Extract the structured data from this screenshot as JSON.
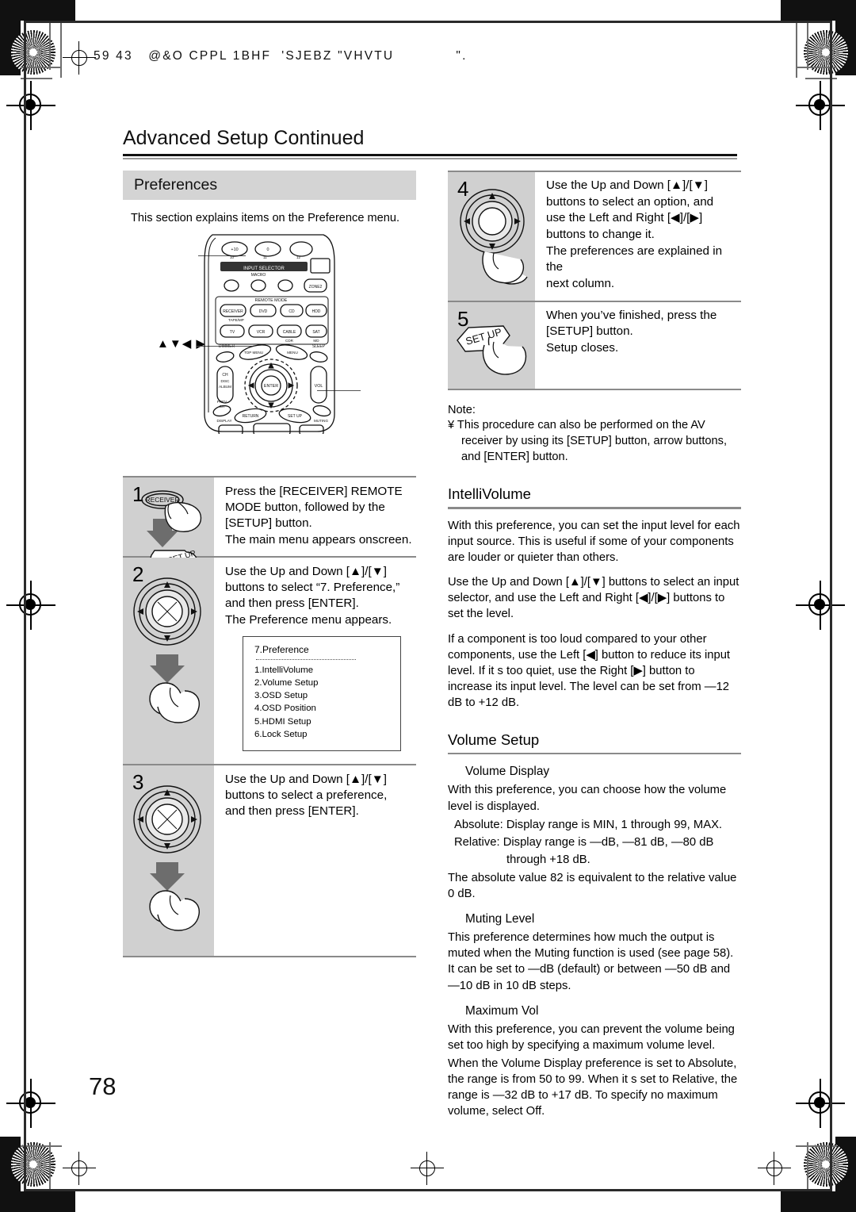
{
  "scan_header": "59 43   @&O CPPL 1BHF  'SJEBZ \"VHVTU            \".",
  "page_title": "Advanced Setup Continued",
  "page_number": "78",
  "left_column": {
    "section_band": "Preferences",
    "intro": "This section explains items on the  Preference  menu.",
    "arrow_label": "▲▼◀ ▶",
    "remote": {
      "caption_buttons": [
        "+10",
        "0",
        "INPUT SELECTOR",
        "MACRO",
        "1",
        "2",
        "3",
        "ZONE2",
        "REMOTE MODE",
        "RECEIVER",
        "DVD",
        "CD",
        "HDD",
        "TV",
        "VCR",
        "CABLE",
        "SAT",
        "TAPE/MP",
        "CDR",
        "MD",
        "DIMMER",
        "SLEEP",
        "TOP MENU",
        "MENU",
        "CH",
        "DISC",
        "ALBUM",
        "ENTER",
        "VOL",
        "PREV CH",
        "RETURN",
        "SET UP",
        "DISPLAY",
        "MUTING"
      ]
    },
    "steps": [
      {
        "num": "1",
        "icon": "receiver-setup-hand-icon",
        "lines": [
          "Press the [RECEIVER] REMOTE",
          "MODE button, followed by the",
          "[SETUP] button.",
          "The main menu appears onscreen."
        ]
      },
      {
        "num": "2",
        "icon": "dial-hand-icon",
        "lines": [
          "Use the Up and Down [▲]/[▼]",
          "buttons to select “7. Preference,”",
          "and then press [ENTER].",
          "The Preference menu appears."
        ],
        "osd": {
          "title": "7.Preference",
          "items": [
            "1.IntelliVolume",
            "2.Volume Setup",
            "3.OSD Setup",
            "4.OSD Position",
            "5.HDMI Setup",
            "6.Lock Setup"
          ]
        }
      },
      {
        "num": "3",
        "icon": "dial-hand-icon",
        "lines": [
          "Use the Up and Down [▲]/[▼]",
          "buttons to select a preference,",
          "and then press [ENTER]."
        ]
      }
    ]
  },
  "right_column": {
    "steps": [
      {
        "num": "4",
        "icon": "dial-hand-icon",
        "lines": [
          "Use the Up and Down [▲]/[▼]",
          "buttons to select an option, and",
          "use the Left and Right [◀]/[▶]",
          "buttons to change it.",
          "The preferences are explained in the",
          "next column."
        ]
      },
      {
        "num": "5",
        "icon": "setup-hand-icon",
        "button_label": "SET UP",
        "lines": [
          "When you’ve finished, press the",
          "[SETUP] button.",
          "Setup closes."
        ]
      }
    ],
    "note": {
      "label": "Note:",
      "bullet": "¥",
      "text": "This procedure can also be performed on the AV receiver by using its [SETUP] button, arrow buttons, and [ENTER] button."
    },
    "intellivolume": {
      "heading": "IntelliVolume",
      "paragraphs": [
        "With this preference, you can set the input level for each input source. This is useful if some of your components are louder or quieter than others.",
        "Use the Up and Down [▲]/[▼] buttons to select an input selector, and use the Left and Right [◀]/[▶] buttons to set the level.",
        "If a component is too loud compared to your other components, use the Left [◀] button to reduce its input level. If it s too quiet, use the Right [▶] button to increase its input level. The level can be set from —12 dB to +12 dB."
      ]
    },
    "volume_setup": {
      "heading": "Volume Setup",
      "subsections": [
        {
          "title": "Volume Display",
          "paragraphs": [
            "With this preference, you can choose how the volume level is displayed."
          ],
          "ranges": [
            {
              "label": "Absolute:",
              "value": "Display range is MIN, 1 through 99, MAX."
            },
            {
              "label": "Relative:",
              "value": "Display range is —dB, —81 dB, —80 dB"
            },
            {
              "label": "",
              "value": "through +18 dB."
            }
          ],
          "after": "The absolute value 82 is equivalent to the relative value 0 dB."
        },
        {
          "title": "Muting Level",
          "paragraphs": [
            "This preference determines how much the output is muted when the Muting function is used (see page 58). It can be set to —dB (default) or between —50 dB and —10 dB in 10 dB steps."
          ]
        },
        {
          "title": "Maximum Vol",
          "paragraphs": [
            "With this preference, you can prevent the volume being set too high by specifying a maximum volume level.",
            "When the  Volume Display  preference is set to  Absolute,  the range is from 50 to 99. When it s set to  Relative,  the range is —32 dB to +17 dB. To specify no maximum volume, select  Off."
          ]
        }
      ]
    }
  }
}
